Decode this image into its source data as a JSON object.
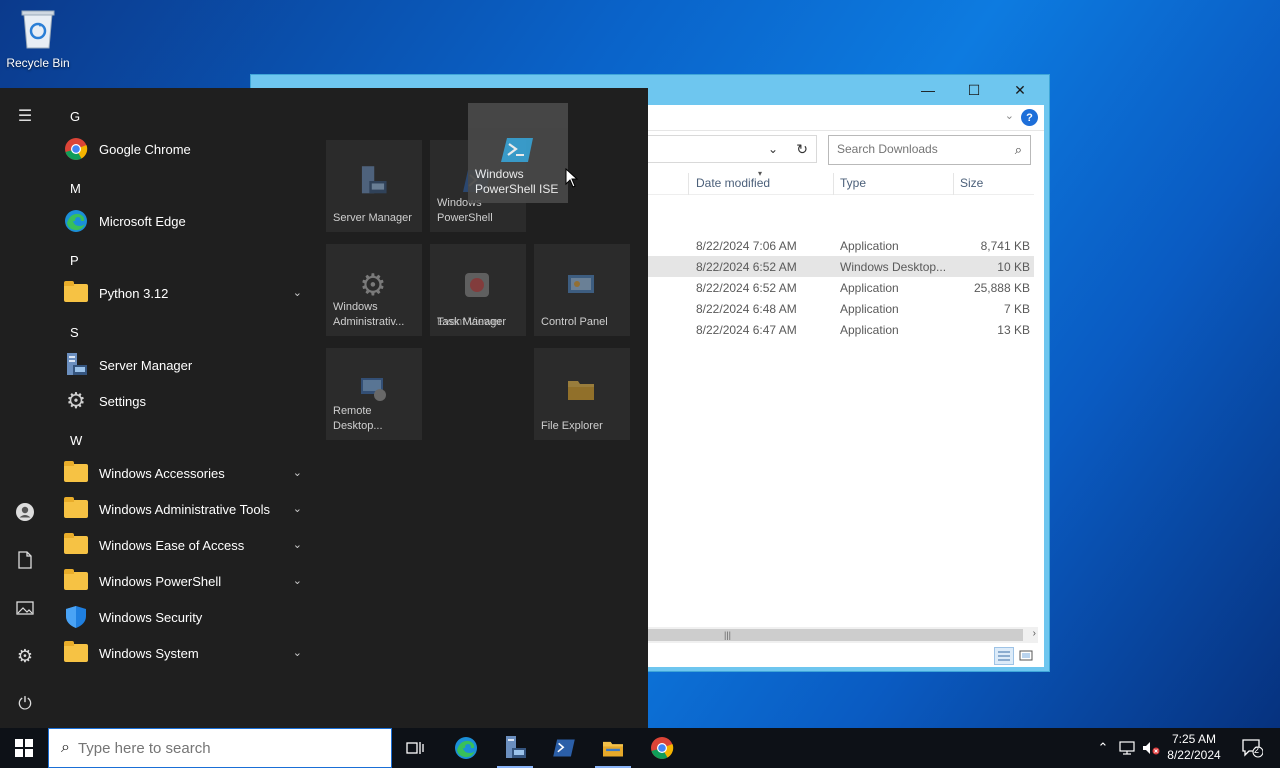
{
  "desktop": {
    "recycle_bin_label": "Recycle Bin"
  },
  "explorer": {
    "window_controls": {
      "minimize": "—",
      "maximize": "☐",
      "close": "✕"
    },
    "help": "?",
    "search_placeholder": "Search Downloads",
    "columns": {
      "date": "Date modified",
      "type": "Type",
      "size": "Size"
    },
    "rows": [
      {
        "date": "8/22/2024 7:06 AM",
        "type": "Application",
        "size": "8,741 KB"
      },
      {
        "date": "8/22/2024 6:52 AM",
        "type": "Windows Desktop...",
        "size": "10 KB"
      },
      {
        "date": "8/22/2024 6:52 AM",
        "type": "Application",
        "size": "25,888 KB"
      },
      {
        "date": "8/22/2024 6:48 AM",
        "type": "Application",
        "size": "7 KB"
      },
      {
        "date": "8/22/2024 6:47 AM",
        "type": "Application",
        "size": "13 KB"
      }
    ]
  },
  "start_menu": {
    "letters": {
      "g": "G",
      "m": "M",
      "p": "P",
      "s": "S",
      "w": "W"
    },
    "apps": {
      "chrome": "Google Chrome",
      "edge": "Microsoft Edge",
      "python": "Python 3.12",
      "server_manager": "Server Manager",
      "settings": "Settings",
      "accessories": "Windows Accessories",
      "admin_tools": "Windows Administrative Tools",
      "ease": "Windows Ease of Access",
      "powershell": "Windows PowerShell",
      "security": "Windows Security",
      "system": "Windows System"
    },
    "tiles": {
      "server_manager": "Server Manager",
      "powershell": "Windows PowerShell",
      "powershell_ise": "Windows PowerShell ISE",
      "admin_tools": "Windows Administrativ...",
      "task_manager": "Task Manager",
      "event_viewer": "Event Viewer",
      "control_panel": "Control Panel",
      "remote_desktop": "Remote Desktop...",
      "file_explorer": "File Explorer"
    }
  },
  "taskbar": {
    "search_placeholder": "Type here to search",
    "time": "7:25 AM",
    "date": "8/22/2024",
    "notifications_count": "2"
  }
}
